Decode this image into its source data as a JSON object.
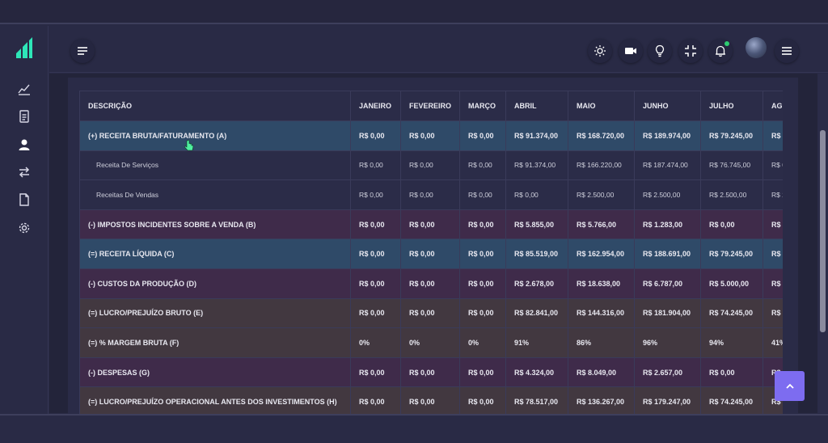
{
  "header": {
    "icons": [
      "menu-toggle-icon",
      "sun-icon",
      "video-icon",
      "lightbulb-icon",
      "compress-icon",
      "bell-icon",
      "avatar",
      "hamburger-icon"
    ]
  },
  "sidebar": {
    "items": [
      "chart-icon",
      "document-icon",
      "user-icon",
      "transfer-icon",
      "file-icon",
      "settings-icon"
    ]
  },
  "table": {
    "columns": [
      "DESCRIÇÃO",
      "JANEIRO",
      "FEVEREIRO",
      "MARÇO",
      "ABRIL",
      "MAIO",
      "JUNHO",
      "JULHO",
      "AG"
    ],
    "rows": [
      {
        "style": "row-blue",
        "cells": [
          "(+) RECEITA BRUTA/FATURAMENTO (A)",
          "R$ 0,00",
          "R$ 0,00",
          "R$ 0,00",
          "R$ 91.374,00",
          "R$ 168.720,00",
          "R$ 189.974,00",
          "R$ 79.245,00",
          "R$"
        ]
      },
      {
        "style": "row-plain",
        "cells": [
          "Receita De Serviços",
          "R$ 0,00",
          "R$ 0,00",
          "R$ 0,00",
          "R$ 91.374,00",
          "R$ 166.220,00",
          "R$ 187.474,00",
          "R$ 76.745,00",
          "R$ 0"
        ]
      },
      {
        "style": "row-plain",
        "cells": [
          "Receitas De Vendas",
          "R$ 0,00",
          "R$ 0,00",
          "R$ 0,00",
          "R$ 0,00",
          "R$ 2.500,00",
          "R$ 2.500,00",
          "R$ 2.500,00",
          "R$ 2"
        ]
      },
      {
        "style": "row-purple",
        "cells": [
          "(-) IMPOSTOS INCIDENTES SOBRE A VENDA (B)",
          "R$ 0,00",
          "R$ 0,00",
          "R$ 0,00",
          "R$ 5.855,00",
          "R$ 5.766,00",
          "R$ 1.283,00",
          "R$ 0,00",
          "R$"
        ]
      },
      {
        "style": "row-blue",
        "cells": [
          "(=) RECEITA LÍQUIDA (C)",
          "R$ 0,00",
          "R$ 0,00",
          "R$ 0,00",
          "R$ 85.519,00",
          "R$ 162.954,00",
          "R$ 188.691,00",
          "R$ 79.245,00",
          "R$"
        ]
      },
      {
        "style": "row-purple",
        "cells": [
          "(-) CUSTOS DA PRODUÇÃO (D)",
          "R$ 0,00",
          "R$ 0,00",
          "R$ 0,00",
          "R$ 2.678,00",
          "R$ 18.638,00",
          "R$ 6.787,00",
          "R$ 5.000,00",
          "R$"
        ]
      },
      {
        "style": "row-brown",
        "cells": [
          "(=) LUCRO/PREJUÍZO BRUTO (E)",
          "R$ 0,00",
          "R$ 0,00",
          "R$ 0,00",
          "R$ 82.841,00",
          "R$ 144.316,00",
          "R$ 181.904,00",
          "R$ 74.245,00",
          "R$"
        ]
      },
      {
        "style": "row-brown",
        "cells": [
          "(=) % MARGEM BRUTA (F)",
          "0%",
          "0%",
          "0%",
          "91%",
          "86%",
          "96%",
          "94%",
          "41%"
        ]
      },
      {
        "style": "row-purple",
        "cells": [
          "(-) DESPESAS (G)",
          "R$ 0,00",
          "R$ 0,00",
          "R$ 0,00",
          "R$ 4.324,00",
          "R$ 8.049,00",
          "R$ 2.657,00",
          "R$ 0,00",
          "R$"
        ]
      },
      {
        "style": "row-brown",
        "cells": [
          "(=) LUCRO/PREJUÍZO OPERACIONAL ANTES DOS INVESTIMENTOS (H)",
          "R$ 0,00",
          "R$ 0,00",
          "R$ 0,00",
          "R$ 78.517,00",
          "R$ 136.267,00",
          "R$ 179.247,00",
          "R$ 74.245,00",
          "R$"
        ]
      }
    ]
  },
  "colors": {
    "accent": "#7d6cf0",
    "logo": "#2ee6b8",
    "row_blue": "#2f4a68",
    "row_purple": "#3f2b4a",
    "row_brown": "#423840"
  }
}
